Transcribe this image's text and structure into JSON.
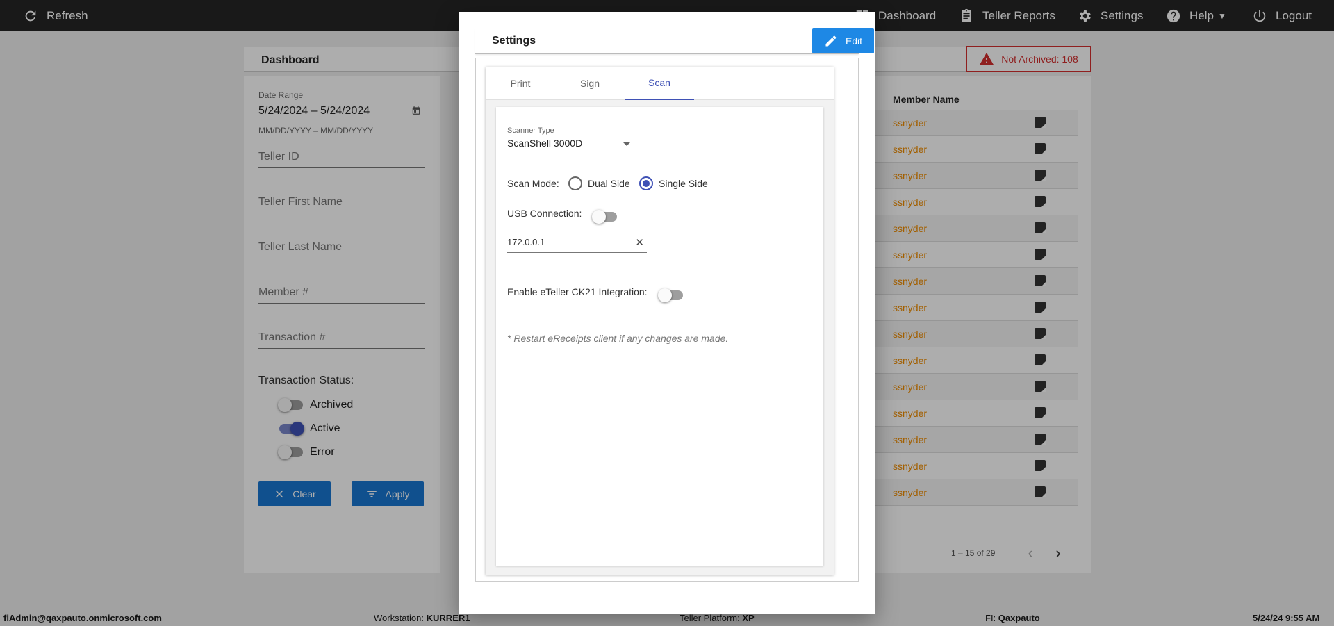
{
  "topbar": {
    "refresh_label": "Refresh",
    "dashboard_label": "Dashboard",
    "teller_reports_label": "Teller Reports",
    "settings_label": "Settings",
    "help_label": "Help",
    "logout_label": "Logout"
  },
  "dashboard": {
    "title": "Dashboard",
    "not_archived": "Not Archived: 108",
    "filters": {
      "date_range_label": "Date Range",
      "date_range_value": "5/24/2024 – 5/24/2024",
      "date_range_hint": "MM/DD/YYYY – MM/DD/YYYY",
      "teller_id": "Teller ID",
      "teller_first_name": "Teller First Name",
      "teller_last_name": "Teller Last Name",
      "member_number": "Member #",
      "transaction_number": "Transaction #",
      "transaction_status_label": "Transaction Status:",
      "statuses": [
        {
          "label": "Archived",
          "on": false
        },
        {
          "label": "Active",
          "on": true
        },
        {
          "label": "Error",
          "on": false
        }
      ],
      "clear_label": "Clear",
      "apply_label": "Apply"
    },
    "table": {
      "column_member_name": "Member Name",
      "rows": [
        "ssnyder",
        "ssnyder",
        "ssnyder",
        "ssnyder",
        "ssnyder",
        "ssnyder",
        "ssnyder",
        "ssnyder",
        "ssnyder",
        "ssnyder",
        "ssnyder",
        "ssnyder",
        "ssnyder",
        "ssnyder",
        "ssnyder"
      ],
      "pagination": "1 – 15 of 29"
    }
  },
  "modal": {
    "title": "Settings",
    "edit_label": "Edit",
    "tabs": [
      "Print",
      "Sign",
      "Scan"
    ],
    "active_tab": "Scan",
    "scan": {
      "scanner_type_label": "Scanner Type",
      "scanner_type_value": "ScanShell 3000D",
      "scan_mode_label": "Scan Mode:",
      "scan_mode_options": [
        "Dual Side",
        "Single Side"
      ],
      "scan_mode_selected": "Single Side",
      "usb_connection_label": "USB Connection:",
      "usb_connection_on": false,
      "ip_address": "172.0.0.1",
      "eteller_label": "Enable eTeller CK21 Integration:",
      "eteller_on": false,
      "restart_note": "* Restart eReceipts client if any changes are made."
    }
  },
  "statusbar": {
    "user": "fiAdmin@qaxpauto.onmicrosoft.com",
    "workstation_label": "Workstation:",
    "workstation_value": "KURRER1",
    "platform_label": "Teller Platform:",
    "platform_value": "XP",
    "fi_label": "FI:",
    "fi_value": "Qaxpauto",
    "datetime": "5/24/24 9:55 AM"
  },
  "colors": {
    "topbar": "#262626",
    "primary_blue": "#1976d2",
    "indigo": "#3f51b5",
    "alert_red": "#d32f2f",
    "member_link": "#ef8c00"
  }
}
